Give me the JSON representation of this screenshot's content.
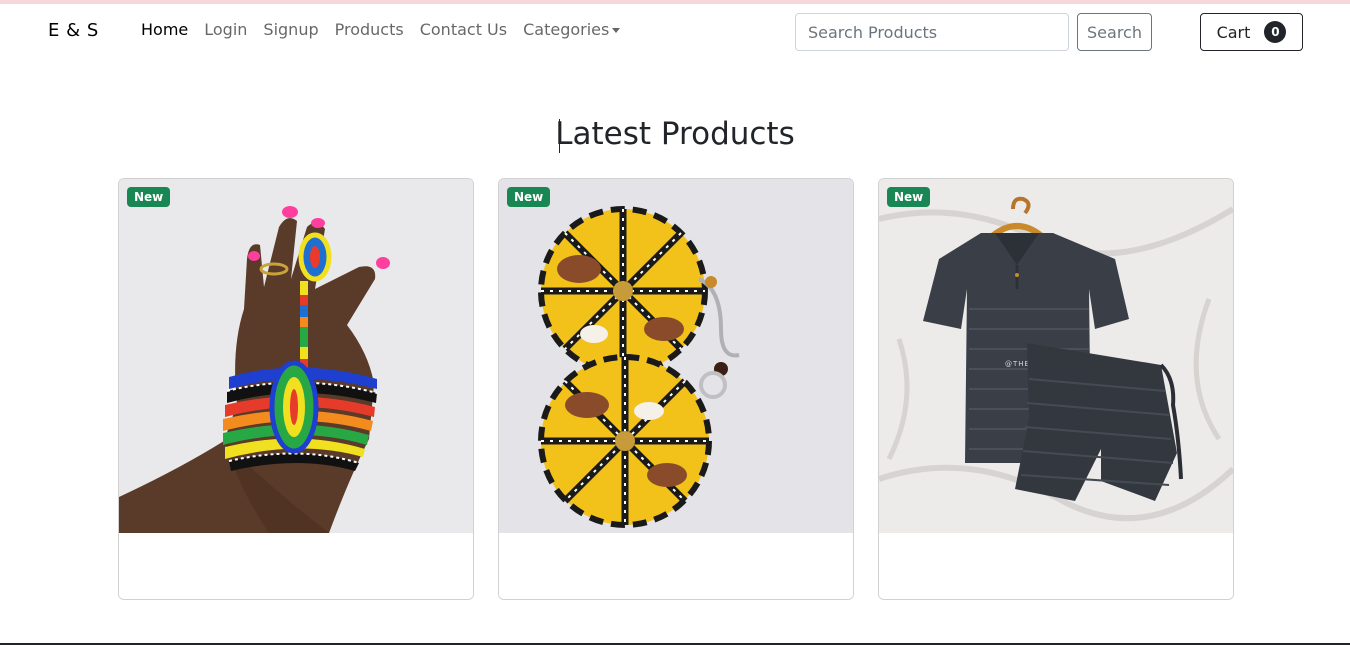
{
  "brand": "E & S",
  "nav": {
    "home": "Home",
    "login": "Login",
    "signup": "Signup",
    "products": "Products",
    "contact": "Contact Us",
    "categories": "Categories"
  },
  "search": {
    "placeholder": "Search Products",
    "button_label": "Search"
  },
  "cart": {
    "label": "Cart",
    "count": "0"
  },
  "section_title": "Latest Products",
  "products": [
    {
      "badge": "New"
    },
    {
      "badge": "New"
    },
    {
      "badge": "New"
    }
  ],
  "colors": {
    "badge": "#198754",
    "accent_strip": "#f8d7da"
  },
  "image_watermark": "@THE_REENABRAND"
}
